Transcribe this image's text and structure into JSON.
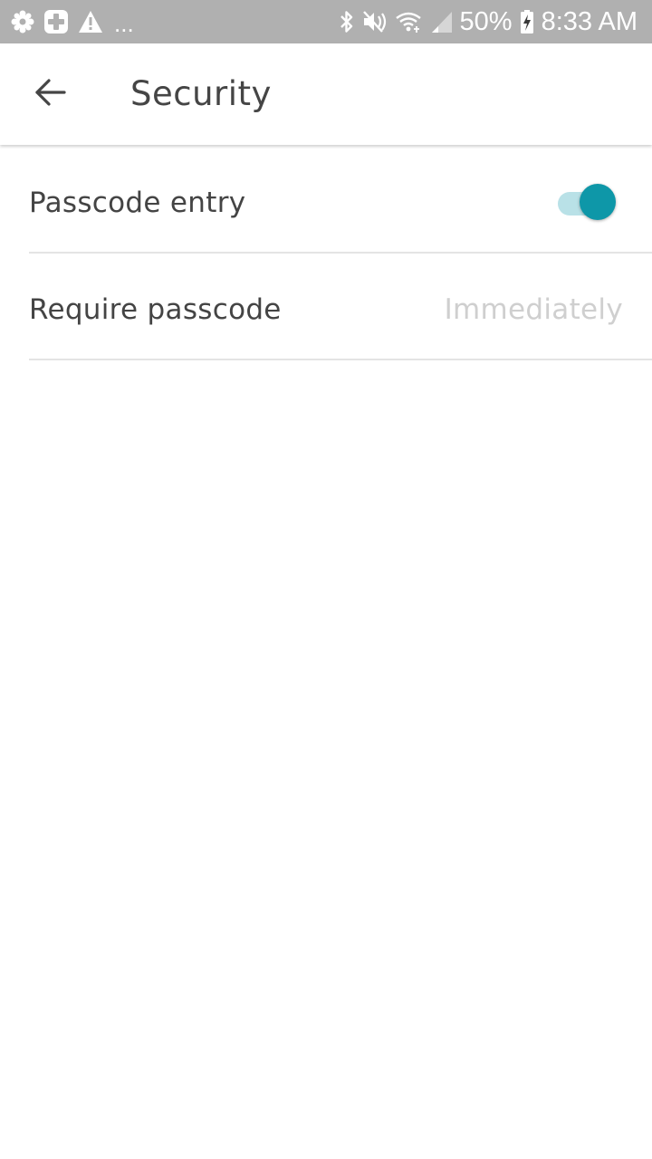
{
  "status_bar": {
    "overflow_dots": "...",
    "battery_percent": "50%",
    "time": "8:33 AM",
    "left_icons": [
      "settings-gear-icon",
      "medical-plus-icon",
      "warning-icon"
    ],
    "right_icons": [
      "bluetooth-icon",
      "mute-icon",
      "wifi-icon",
      "signal-icon",
      "battery-charging-icon"
    ]
  },
  "app_bar": {
    "back_icon": "arrow-left-icon",
    "title": "Security"
  },
  "settings": {
    "passcode_entry": {
      "label": "Passcode entry",
      "enabled": true
    },
    "require_passcode": {
      "label": "Require passcode",
      "value": "Immediately"
    }
  },
  "colors": {
    "accent": "#0e97a8",
    "accent_track": "#b9e1e7",
    "status_bar": "#b0b0b0",
    "text_primary": "#444444",
    "text_disabled": "#cfcfcf",
    "divider": "#e4e4e4"
  }
}
